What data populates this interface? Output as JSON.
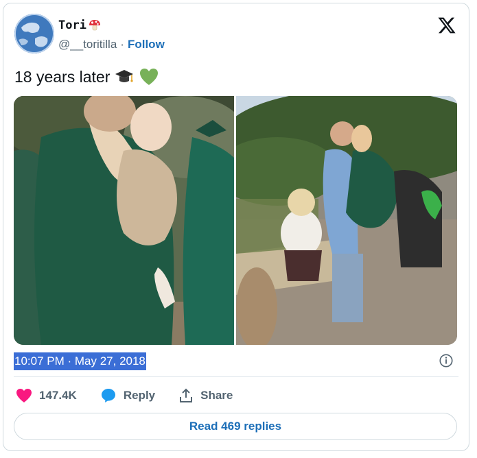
{
  "author": {
    "name": "Tori",
    "handle": "@__toritilla",
    "separator": "·",
    "follow_label": "Follow",
    "avatar_icon": "globe-icon",
    "name_emoji": "mushroom-icon"
  },
  "brand": {
    "logo": "x-logo-icon"
  },
  "tweet": {
    "text": "18 years later",
    "emojis": [
      "graduation-cap-icon",
      "green-heart-icon"
    ]
  },
  "media": [
    {
      "kind": "photo",
      "subject": "graduation-1999"
    },
    {
      "kind": "photo",
      "subject": "graduation-2018"
    }
  ],
  "meta": {
    "timestamp": "10:07 PM · May 27, 2018"
  },
  "actions": {
    "like_count": "147.4K",
    "reply_label": "Reply",
    "share_label": "Share"
  },
  "footer": {
    "read_replies_label": "Read 469 replies"
  },
  "colors": {
    "link": "#1d6fb8",
    "like": "#f91880",
    "reply": "#1d9bf0",
    "selection": "#3b6ed6",
    "gown_green": "#1f5a44"
  }
}
